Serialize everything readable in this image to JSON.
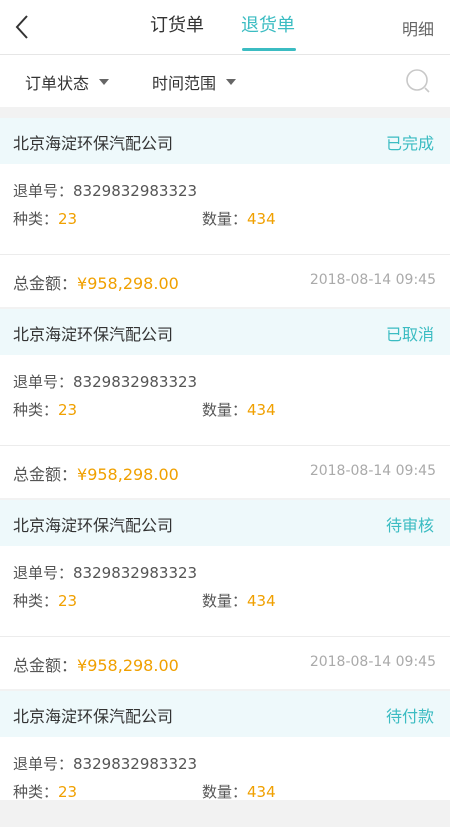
{
  "header": {
    "tabs": [
      {
        "label": "订货单",
        "active": false
      },
      {
        "label": "退货单",
        "active": true
      }
    ],
    "detail_label": "明细"
  },
  "filters": {
    "status_label": "订单状态",
    "time_label": "时间范围"
  },
  "labels": {
    "order_no": "退单号：",
    "kinds": "种类：",
    "quantity": "数量：",
    "total": "总金额："
  },
  "orders": [
    {
      "company": "北京海淀环保汽配公司",
      "status": "已完成",
      "order_no": "8329832983323",
      "kinds": "23",
      "quantity": "434",
      "total": "¥958,298.00",
      "time": "2018-08-14 09:45"
    },
    {
      "company": "北京海淀环保汽配公司",
      "status": "已取消",
      "order_no": "8329832983323",
      "kinds": "23",
      "quantity": "434",
      "total": "¥958,298.00",
      "time": "2018-08-14 09:45"
    },
    {
      "company": "北京海淀环保汽配公司",
      "status": "待审核",
      "order_no": "8329832983323",
      "kinds": "23",
      "quantity": "434",
      "total": "¥958,298.00",
      "time": "2018-08-14 09:45"
    },
    {
      "company": "北京海淀环保汽配公司",
      "status": "待付款",
      "order_no": "8329832983323",
      "kinds": "23",
      "quantity": "434",
      "total": "",
      "time": ""
    }
  ],
  "colors": {
    "accent": "#3bbcc2",
    "value": "#f0a000"
  }
}
